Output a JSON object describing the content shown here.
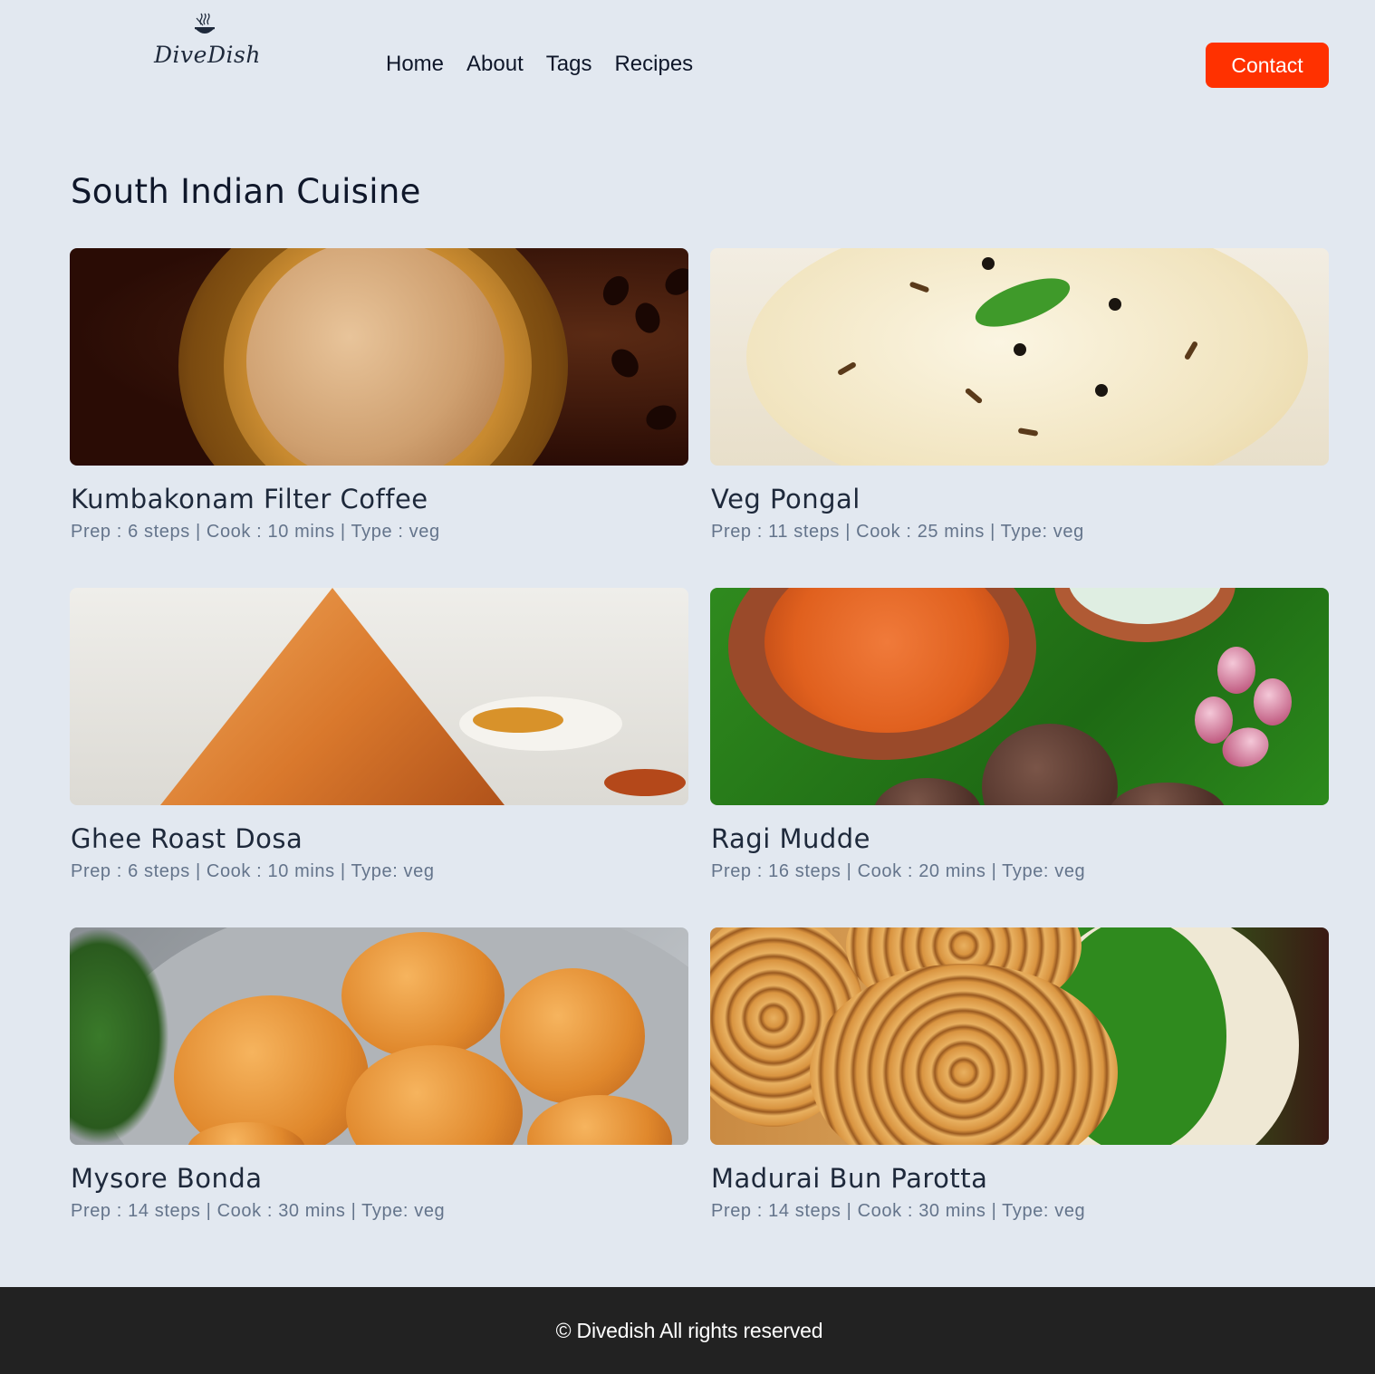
{
  "brand": {
    "name": "DiveDish",
    "icon": "steaming-bowl-icon"
  },
  "nav": {
    "links": [
      "Home",
      "About",
      "Tags",
      "Recipes"
    ],
    "contact_label": "Contact"
  },
  "page": {
    "title": "South Indian Cuisine"
  },
  "recipes": [
    {
      "title": "Kumbakonam Filter Coffee",
      "meta": "Prep : 6 steps | Cook : 10 mins | Type : veg",
      "image": "filter-coffee-photo"
    },
    {
      "title": "Veg Pongal",
      "meta": "Prep : 11 steps | Cook : 25 mins | Type: veg",
      "image": "veg-pongal-photo"
    },
    {
      "title": "Ghee Roast Dosa",
      "meta": "Prep : 6 steps | Cook : 10 mins | Type: veg",
      "image": "ghee-roast-dosa-photo"
    },
    {
      "title": "Ragi Mudde",
      "meta": "Prep : 16 steps | Cook : 20 mins | Type: veg",
      "image": "ragi-mudde-photo"
    },
    {
      "title": "Mysore Bonda",
      "meta": "Prep : 14 steps | Cook : 30 mins | Type: veg",
      "image": "mysore-bonda-photo"
    },
    {
      "title": "Madurai Bun Parotta",
      "meta": "Prep : 14 steps | Cook : 30 mins | Type: veg",
      "image": "madurai-bun-parotta-photo"
    }
  ],
  "footer": {
    "text": "© Divedish All rights reserved"
  },
  "colors": {
    "accent": "#ff3100",
    "background": "#e2e8f0",
    "footer_bg": "#222222",
    "meta_text": "#64748b"
  }
}
